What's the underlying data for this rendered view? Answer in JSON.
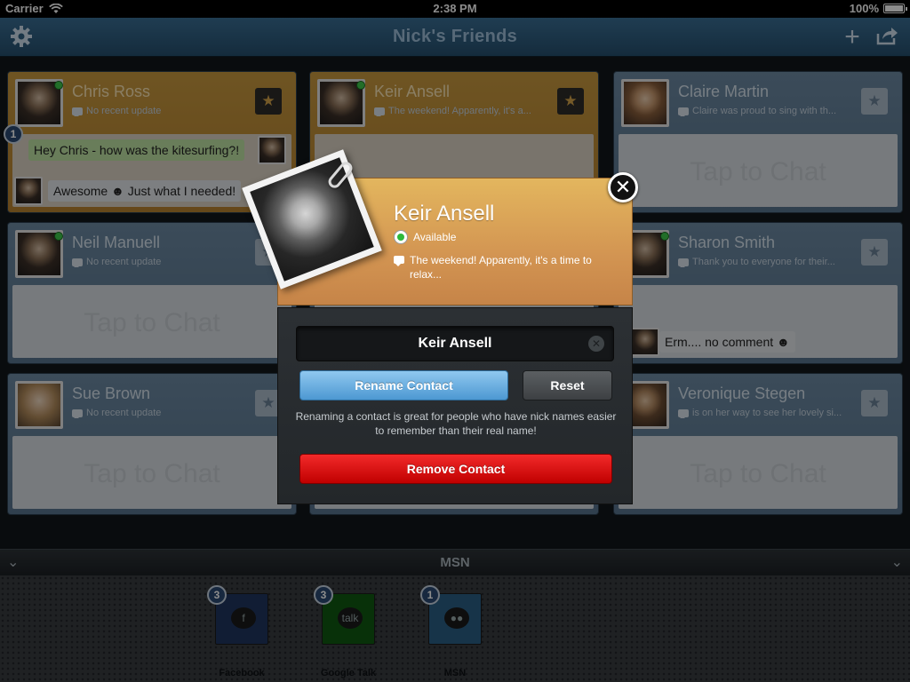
{
  "status_bar": {
    "carrier": "Carrier",
    "time": "2:38 PM",
    "battery": "100%"
  },
  "nav": {
    "title": "Nick's Friends",
    "settings_icon": "gear-icon",
    "add_icon": "plus-icon",
    "share_icon": "share-icon"
  },
  "cards": [
    {
      "name": "Chris Ross",
      "status": "No recent update",
      "badge": "1",
      "messages": [
        "Hey Chris - how was the kitesurfing?!",
        "Awesome ☻ Just what I needed!"
      ]
    },
    {
      "name": "Keir Ansell",
      "status": "The weekend! Apparently, it's a..."
    },
    {
      "name": "Claire Martin",
      "status": "Claire was proud to sing with th...",
      "body": "Tap to Chat"
    },
    {
      "name": "Neil Manuell",
      "status": "No recent update",
      "body": "Tap to Chat"
    },
    {
      "name": "Sharon Smith",
      "status": "Thank you to everyone for their...",
      "messages": [
        "Erm.... no comment ☻"
      ]
    },
    {
      "name": "Sue Brown",
      "status": "No recent update",
      "body": "Tap to Chat"
    },
    {
      "name": "Veronique Stegen",
      "status": "is on her way to see her lovely si...",
      "body": "Tap to Chat"
    }
  ],
  "modal": {
    "name": "Keir Ansell",
    "availability": "Available",
    "status": "The weekend! Apparently, it's a time to relax...",
    "field_value": "Keir Ansell",
    "rename_label": "Rename Contact",
    "reset_label": "Reset",
    "hint": "Renaming a contact is great for people who have nick names easier to remember than their real name!",
    "remove_label": "Remove Contact"
  },
  "tray": {
    "title": "MSN",
    "items": [
      {
        "label": "Facebook",
        "badge": "3",
        "color": "#1f3560",
        "glyph": "f"
      },
      {
        "label": "Google Talk",
        "badge": "3",
        "color": "#0f5a12",
        "glyph": "talk"
      },
      {
        "label": "MSN",
        "badge": "1",
        "color": "#2a5f86",
        "glyph": "●●"
      }
    ]
  }
}
